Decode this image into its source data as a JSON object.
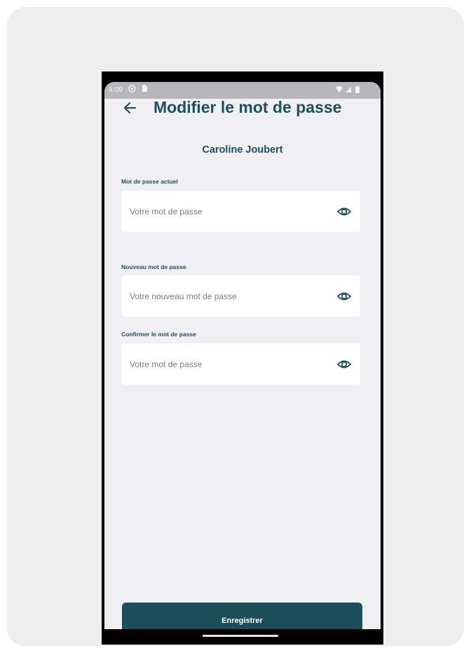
{
  "status_bar": {
    "time": "8:09"
  },
  "header": {
    "title": "Modifier le mot de passe"
  },
  "user": {
    "name": "Caroline Joubert"
  },
  "fields": [
    {
      "label": "Mot de passe actuel",
      "placeholder": "Votre mot de passe",
      "icon": "eye-icon"
    },
    {
      "label": "Nouveau mot de passe",
      "placeholder": "Votre nouveau mot de passe",
      "icon": "eye-icon"
    },
    {
      "label": "Confirmer le mot de passe",
      "placeholder": "Votre mot de passe",
      "icon": "eye-icon"
    }
  ],
  "actions": {
    "save_label": "Enregistrer"
  },
  "colors": {
    "primary": "#1b4d5b",
    "screen_background": "#efeff4",
    "outer_background": "#eeeeee"
  }
}
